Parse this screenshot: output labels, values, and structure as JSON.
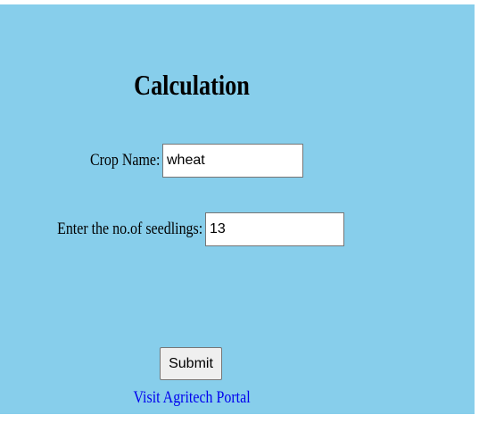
{
  "form": {
    "title": "Calculation",
    "crop_name": {
      "label": "Crop Name:",
      "value": "wheat"
    },
    "seedlings": {
      "label": "Enter the no.of seedlings:",
      "value": "13"
    },
    "submit_label": "Submit",
    "link_text": "Visit Agritech Portal"
  },
  "colors": {
    "background": "#87ceeb",
    "link": "#0000ee"
  }
}
